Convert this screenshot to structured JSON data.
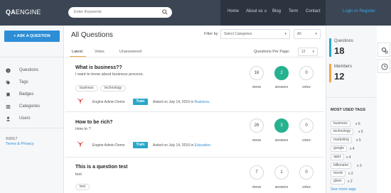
{
  "header": {
    "logo_bold": "QA",
    "logo_rest": "ENGINE",
    "search_placeholder": "Enter Keywords",
    "nav": [
      "Home",
      "About us",
      "Blog",
      "Term",
      "Contact"
    ],
    "login_label": "Login or Register"
  },
  "left_sidebar": {
    "ask_label": "+ ASK A QUESTION",
    "items": [
      "Questions",
      "Tags",
      "Badges",
      "Categories",
      "Users"
    ],
    "copyright": "©2017",
    "privacy": "Terms & Privacy"
  },
  "main": {
    "title": "All Questions",
    "filter_label": "Filter by",
    "category_select": "Select Categories",
    "all_select": "All",
    "tabs": [
      "Latest",
      "Votes",
      "Unanswered"
    ],
    "per_page_label": "Questions Per Page:",
    "per_page_value": "12",
    "questions": [
      {
        "title": "What is business??",
        "text": "I want to know about business process.",
        "tags": [
          "business",
          "technology"
        ],
        "author": "Engine Admin Demo",
        "badge": "Train",
        "asked_prefix": "Asked on July 14, 2016 in",
        "category": "Business.",
        "views": "16",
        "answers": "2",
        "votes": "0"
      },
      {
        "title": "How to be rich?",
        "text": "How to ?",
        "tags": [],
        "author": "Engine Admin Demo",
        "badge": "Train",
        "asked_prefix": "Asked on July 14, 2016 in",
        "category": "Education.",
        "views": "26",
        "answers": "3",
        "votes": "0"
      },
      {
        "title": "This is a question test",
        "text": "test",
        "tags": [
          "test"
        ],
        "author": "",
        "badge": "",
        "asked_prefix": "",
        "category": "",
        "views": "7",
        "answers": "1",
        "votes": "0"
      }
    ],
    "stat_labels": {
      "views": "views",
      "answers": "answers",
      "votes": "votes"
    }
  },
  "right_sidebar": {
    "questions_label": "Questions",
    "questions_count": "18",
    "members_label": "Members",
    "members_count": "12",
    "most_used_title": "MOST USED TAGS",
    "tags": [
      {
        "name": "business",
        "count": "x 6"
      },
      {
        "name": "technology",
        "count": "x 5"
      },
      {
        "name": "marketing",
        "count": "x 5"
      },
      {
        "name": "google",
        "count": "x 4"
      },
      {
        "name": "apps",
        "count": "x 4"
      },
      {
        "name": "billionaire",
        "count": "x 3"
      },
      {
        "name": "movie",
        "count": "x 2"
      },
      {
        "name": "glass",
        "count": "x 2"
      }
    ],
    "see_more": "See more tags"
  },
  "colors": {
    "topbar": "#3b4554",
    "accent_blue": "#2d8ed7",
    "answer_green": "#27b28f",
    "questions_bar": "#2aa6c9",
    "members_bar": "#f0a646"
  }
}
